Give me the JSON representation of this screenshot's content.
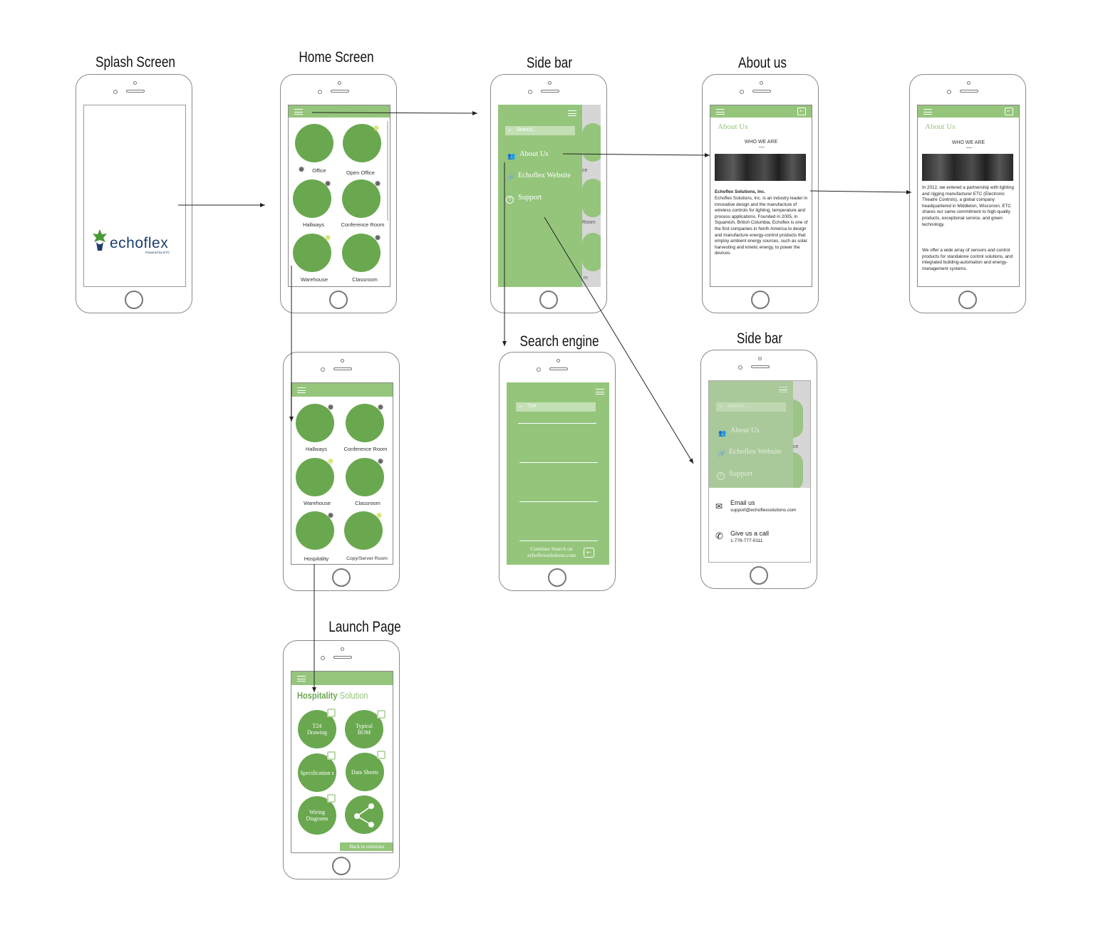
{
  "titles": {
    "splash": "Splash Screen",
    "home": "Home Screen",
    "sidebar1": "Side bar",
    "about": "About us",
    "search": "Search engine",
    "sidebar2": "Side bar",
    "launch": "Launch Page"
  },
  "brand": {
    "logo": "echoflex",
    "tagline": "Powered by ETC"
  },
  "home": {
    "rooms": [
      "Office",
      "Open Office",
      "Hallways",
      "Conference Room",
      "Warehouse",
      "Classroom"
    ]
  },
  "home2": {
    "rooms": [
      "Hallways",
      "Conference Room",
      "Warehouse",
      "Classroom",
      "Hospitality",
      "Copy/Server Room"
    ]
  },
  "sidebar": {
    "search_placeholder": "Search...",
    "items": [
      "About Us",
      "Echoflex Website",
      "Support"
    ],
    "peek": [
      "ce",
      "Room",
      "m"
    ]
  },
  "about": {
    "title": "About Us",
    "subtitle": "WHO WE ARE",
    "company": "Echoflex Solutions, Inc.",
    "para1": "Echoflex Solutions, Inc. is an industry leader in innovative design and the manufacture of wireless controls for lighting, temperature and process applications. Founded in 2005, in Squamish, British Columbia, Echoflex is one of the first companies in North America to design and manufacture energy-control products that employ ambient energy sources, such as solar harvesting and kinetic energy, to power the devices.",
    "para2": "In 2012, we entered a partnership with lighting and rigging manufacturer ETC (Electronic Theatre Controls), a global company headquartered in Middleton, Wisconsin. ETC shares our same commitment to high-quality products, exceptional service, and green technology.",
    "para3": "We offer a wide array of sensors and control products for standalone control solutions, and integrated building-automation and energy-management systems."
  },
  "search": {
    "query": "T24",
    "continue": "Continue Search on echoflexsolutions.com"
  },
  "support": {
    "email_label": "Email us",
    "email": "support@echoflexsolutions.com",
    "call_label": "Give us a call",
    "phone": "1-778-777-0111"
  },
  "launch": {
    "title_bold": "Hospitality",
    "title_rest": " Solution",
    "buttons": [
      "T24 Drawing",
      "Typical BOM",
      "Specification s",
      "Data Sheets",
      "Wiring Diagrams"
    ],
    "back": "Back to solutions"
  },
  "colors": {
    "green": "#6aa84f",
    "light_green": "#94c57b",
    "logo_blue": "#1d3e6e"
  }
}
